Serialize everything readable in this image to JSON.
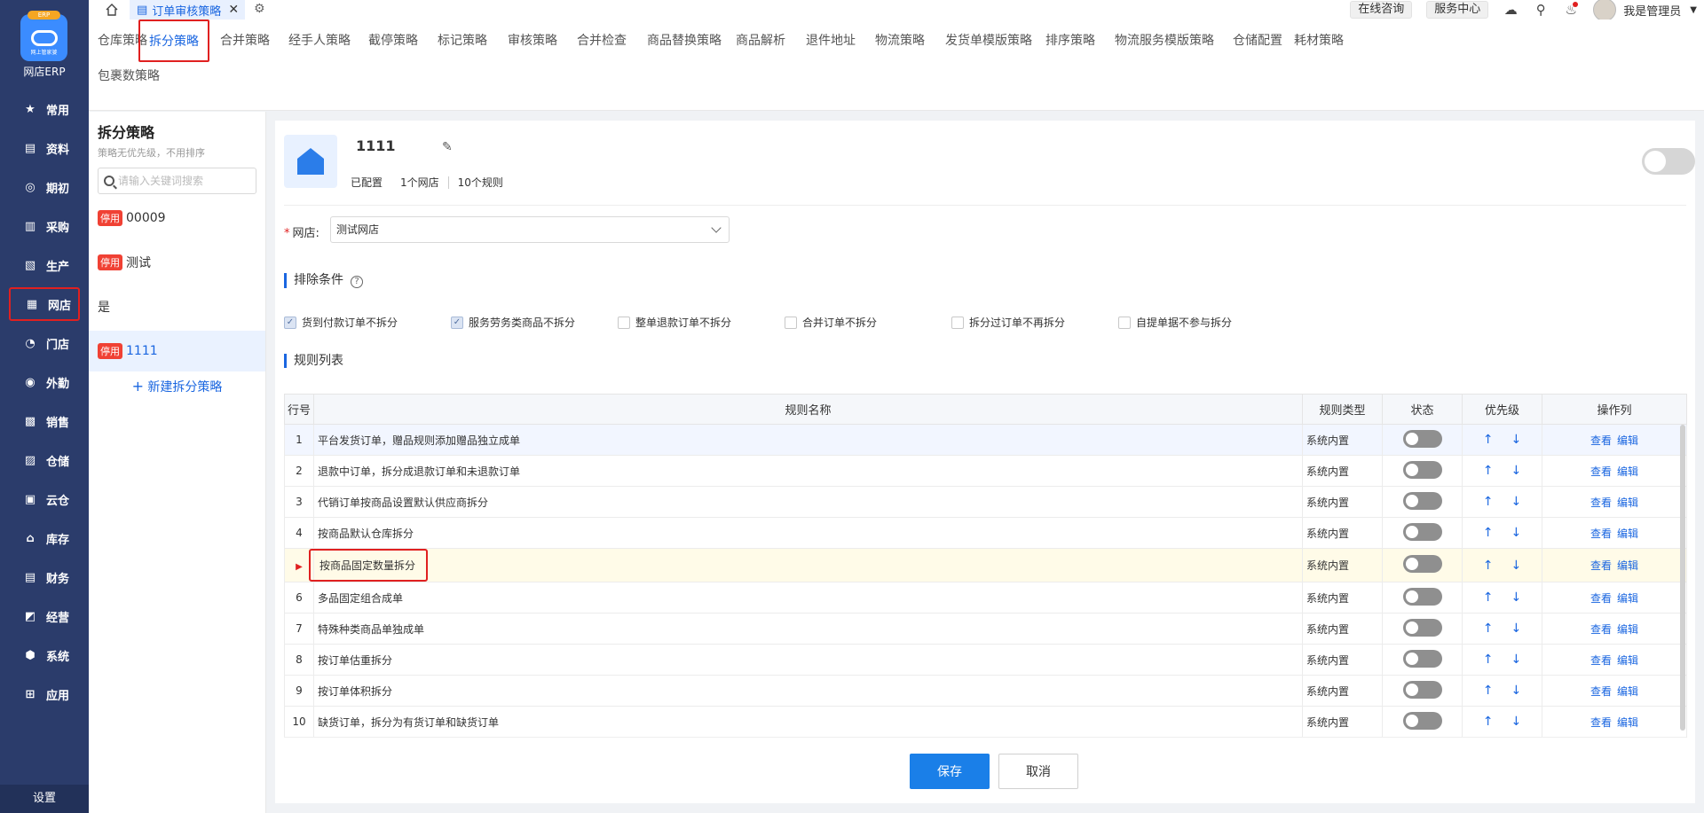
{
  "sidebar": {
    "logo_tag": "ERP",
    "logo_sub": "网上管家婆",
    "brand": "网店ERP",
    "items": [
      {
        "label": "常用",
        "icon": "star-icon"
      },
      {
        "label": "资料",
        "icon": "chart-icon"
      },
      {
        "label": "期初",
        "icon": "target-icon"
      },
      {
        "label": "采购",
        "icon": "purchase-icon"
      },
      {
        "label": "生产",
        "icon": "document-icon"
      },
      {
        "label": "网店",
        "icon": "store-icon"
      },
      {
        "label": "门店",
        "icon": "pie-icon"
      },
      {
        "label": "外勤",
        "icon": "field-icon"
      },
      {
        "label": "销售",
        "icon": "bar-chart-icon"
      },
      {
        "label": "仓储",
        "icon": "warehouse-icon"
      },
      {
        "label": "云仓",
        "icon": "cloud-warehouse-icon"
      },
      {
        "label": "库存",
        "icon": "home-icon"
      },
      {
        "label": "财务",
        "icon": "finance-icon"
      },
      {
        "label": "经营",
        "icon": "trend-icon"
      },
      {
        "label": "系统",
        "icon": "system-icon"
      },
      {
        "label": "应用",
        "icon": "app-icon"
      }
    ],
    "settings": "设置"
  },
  "titlebar": {
    "tab_label": "订单审核策略",
    "consult": "在线咨询",
    "service": "服务中心",
    "user": "我是管理员"
  },
  "subnav": {
    "row1": [
      "仓库策略",
      "拆分策略",
      "合并策略",
      "经手人策略",
      "截停策略",
      "标记策略",
      "审核策略",
      "合并检查",
      "商品替换策略",
      "商品解析",
      "退件地址",
      "物流策略",
      "发货单模版策略",
      "排序策略",
      "物流服务模版策略",
      "仓储配置",
      "耗材策略"
    ],
    "row2": [
      "包裹数策略"
    ],
    "active": "拆分策略"
  },
  "strategy_list": {
    "title": "拆分策略",
    "subtitle": "策略无优先级，不用排序",
    "search_placeholder": "请输入关键词搜索",
    "badge": "停用",
    "items": [
      {
        "name": "00009",
        "disabled": true
      },
      {
        "name": "测试",
        "disabled": true
      },
      {
        "name": "是",
        "disabled": false
      },
      {
        "name": "1111",
        "disabled": true,
        "selected": true
      }
    ],
    "new_label": "新建拆分策略"
  },
  "card": {
    "name": "1111",
    "configured": "已配置",
    "shops": "1个网店",
    "rules": "10个规则",
    "shop_label": "网店:",
    "shop_value": "测试网店",
    "exclusion_title": "排除条件",
    "exclusions": [
      {
        "label": "货到付款订单不拆分",
        "checked": true
      },
      {
        "label": "服务劳务类商品不拆分",
        "checked": true
      },
      {
        "label": "整单退款订单不拆分",
        "checked": false
      },
      {
        "label": "合并订单不拆分",
        "checked": false
      },
      {
        "label": "拆分过订单不再拆分",
        "checked": false
      },
      {
        "label": "自提单据不参与拆分",
        "checked": false
      }
    ],
    "rules_title": "规则列表"
  },
  "table": {
    "headers": {
      "no": "行号",
      "name": "规则名称",
      "type": "规则类型",
      "status": "状态",
      "priority": "优先级",
      "ops": "操作列"
    },
    "view": "查看",
    "edit": "编辑",
    "rows": [
      {
        "no": "1",
        "name": "平台发货订单，赠品规则添加赠品独立成单",
        "type": "系统内置"
      },
      {
        "no": "2",
        "name": "退款中订单，拆分成退款订单和未退款订单",
        "type": "系统内置"
      },
      {
        "no": "3",
        "name": "代销订单按商品设置默认供应商拆分",
        "type": "系统内置"
      },
      {
        "no": "4",
        "name": "按商品默认仓库拆分",
        "type": "系统内置"
      },
      {
        "no": "",
        "name": "按商品固定数量拆分",
        "type": "系统内置",
        "current": true
      },
      {
        "no": "6",
        "name": "多品固定组合成单",
        "type": "系统内置"
      },
      {
        "no": "7",
        "name": "特殊种类商品单独成单",
        "type": "系统内置"
      },
      {
        "no": "8",
        "name": "按订单估重拆分",
        "type": "系统内置"
      },
      {
        "no": "9",
        "name": "按订单体积拆分",
        "type": "系统内置"
      },
      {
        "no": "10",
        "name": "缺货订单，拆分为有货订单和缺货订单",
        "type": "系统内置"
      }
    ]
  },
  "footer": {
    "save": "保存",
    "cancel": "取消"
  }
}
